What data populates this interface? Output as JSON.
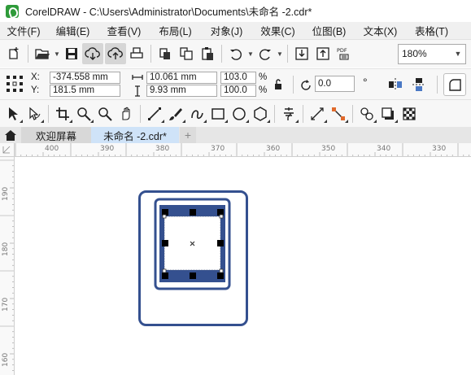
{
  "window": {
    "title": "CorelDRAW - C:\\Users\\Administrator\\Documents\\未命名 -2.cdr*"
  },
  "menu": [
    "文件(F)",
    "编辑(E)",
    "查看(V)",
    "布局(L)",
    "对象(J)",
    "效果(C)",
    "位图(B)",
    "文本(X)",
    "表格(T)"
  ],
  "toolbar": {
    "zoom_value": "180%",
    "pdf_label": "PDF"
  },
  "properties": {
    "x_label": "X:",
    "y_label": "Y:",
    "x_value": "-374.558 mm",
    "y_value": "181.5 mm",
    "width_value": "10.061 mm",
    "height_value": "9.93 mm",
    "scale_w": "103.0",
    "scale_h": "100.0",
    "percent": "%",
    "rotation": "0.0",
    "degree": "°"
  },
  "tabs": {
    "welcome": "欢迎屏幕",
    "document": "未命名 -2.cdr*",
    "add": "+"
  },
  "rulers": {
    "horizontal": [
      "400",
      "390",
      "380",
      "370",
      "360",
      "350",
      "340",
      "330"
    ],
    "vertical": [
      "190",
      "180",
      "170",
      "160"
    ]
  },
  "colors": {
    "shape_blue": "#34508f",
    "tab_active": "#cfe3f8"
  },
  "icons": [
    "new-document-icon",
    "open-folder-icon",
    "save-icon",
    "cloud-download-icon",
    "cloud-upload-icon",
    "print-icon",
    "copy-icon",
    "paste-icon",
    "clipboard-icon",
    "undo-icon",
    "redo-icon",
    "import-icon",
    "export-icon",
    "pdf-icon"
  ]
}
